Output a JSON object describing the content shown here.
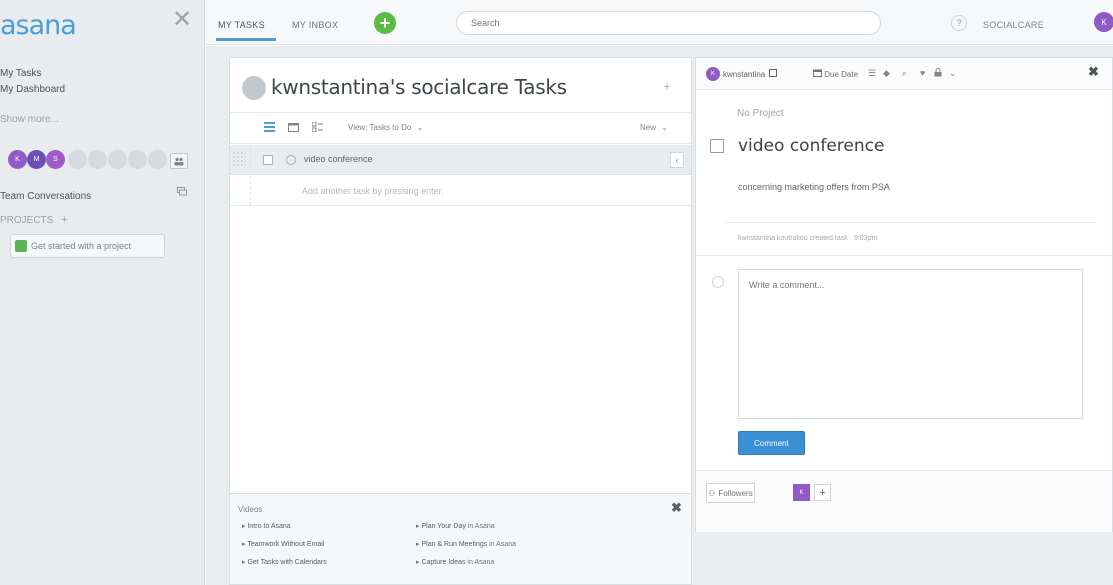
{
  "sidebar": {
    "logo": "asana",
    "close": "✕",
    "my_tasks": "My Tasks",
    "my_dashboard": "My Dashboard",
    "show_more": "Show more...",
    "avatar_letters": [
      "K",
      "M",
      "S"
    ],
    "team_conversations": "Team Conversations",
    "projects_label": "PROJECTS",
    "projects_add": "+",
    "get_started": "Get started with a project"
  },
  "topbar": {
    "tabs": [
      "MY TASKS",
      "MY INBOX"
    ],
    "add": "+",
    "search_placeholder": "Search",
    "help": "?",
    "workspace": "SOCIALCARE",
    "user_initial": "K"
  },
  "task_pane": {
    "title": "kwnstantina's socialcare Tasks",
    "plus": "+",
    "view": "View: Tasks to Do",
    "new": "New",
    "tasks": [
      {
        "name": "video conference"
      }
    ],
    "add_placeholder": "Add another task by pressing enter."
  },
  "videos": {
    "title": "Videos",
    "close": "✖",
    "col1": [
      {
        "main": "Intro to Asana",
        "suffix": ""
      },
      {
        "main": "Teamwork Without Email",
        "suffix": ""
      },
      {
        "main": "Get Tasks with Calendars",
        "suffix": ""
      }
    ],
    "col2": [
      {
        "main": "Plan Your Day",
        "suffix": " in Asana"
      },
      {
        "main": "Plan & Run Meetings",
        "suffix": " in Asana"
      },
      {
        "main": "Capture Ideas",
        "suffix": " in Asana"
      }
    ]
  },
  "detail": {
    "assignee": "kwnstantina",
    "assignee_initial": "K",
    "due_date": "Due Date",
    "close": "✖",
    "no_project": "No Project",
    "title": "video conference",
    "description": "concerning marketing offers from PSA",
    "meta": "kwnstantina koutrakou created task · 9:03pm",
    "comment_placeholder": "Write a comment...",
    "comment_button": "Comment",
    "followers": "Followers",
    "follower_initial": "K",
    "add_follower": "+"
  },
  "colors": {
    "brand": "#4a9fd8",
    "add_green": "#5cba47",
    "user_purple": "#8e5bc7",
    "comment_blue": "#3a8fd5"
  }
}
